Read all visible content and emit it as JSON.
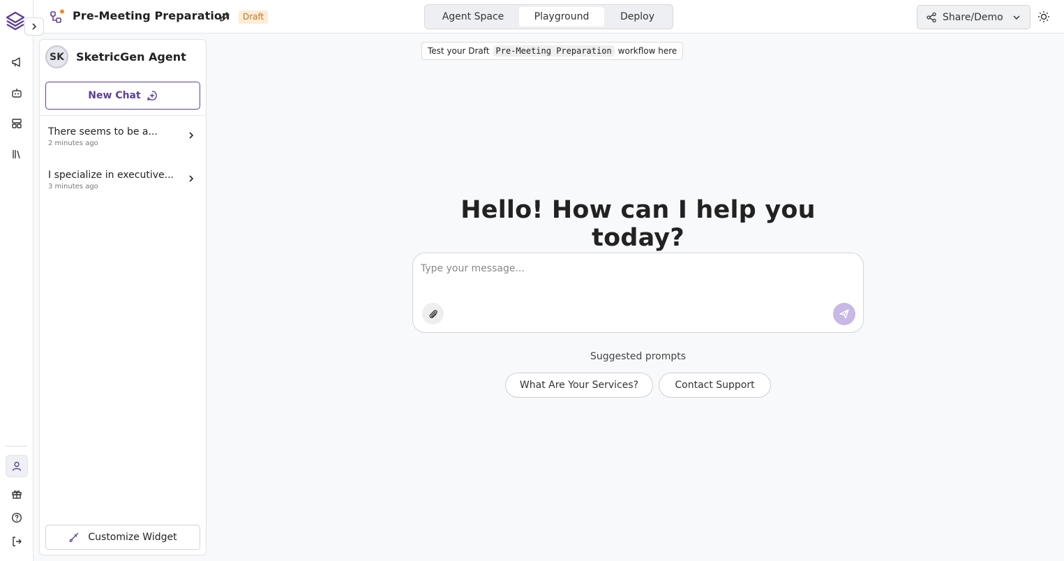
{
  "workflow": {
    "title": "Pre-Meeting Preparation",
    "status_badge": "Draft"
  },
  "tabs": [
    {
      "label": "Agent Space"
    },
    {
      "label": "Playground",
      "active": true
    },
    {
      "label": "Deploy"
    }
  ],
  "share": {
    "label": "Share/Demo"
  },
  "hint": {
    "prefix": "Test your Draft",
    "workflow_name": "Pre-Meeting Preparation",
    "suffix": "workflow here"
  },
  "side_panel": {
    "avatar_initials": "SK",
    "agent_name": "SketricGen Agent",
    "new_chat_label": "New Chat",
    "chats": [
      {
        "title": "There seems to be a...",
        "time": "2 minutes ago"
      },
      {
        "title": "I specialize in executive...",
        "time": "3 minutes ago"
      }
    ],
    "customize_label": "Customize Widget"
  },
  "main": {
    "greeting": "Hello! How can I help you today?",
    "input_placeholder": "Type your message...",
    "suggested_label": "Suggested prompts",
    "suggested_prompts": [
      "What Are Your Services?",
      "Contact Support"
    ]
  },
  "icons": {
    "rail": [
      "logo-icon",
      "expand-icon",
      "megaphone-icon",
      "bot-icon",
      "layout-icon",
      "library-icon",
      "user-icon",
      "gift-icon",
      "help-icon",
      "logout-icon"
    ],
    "header": [
      "workflow-icon",
      "edit-icon",
      "share-icon",
      "chevron-down-icon",
      "sun-icon"
    ]
  },
  "colors": {
    "accent": "#5b3f9a",
    "draft_badge_bg": "#fdecd6",
    "draft_badge_text": "#c0762a",
    "send_button": "#c7b8e6"
  }
}
